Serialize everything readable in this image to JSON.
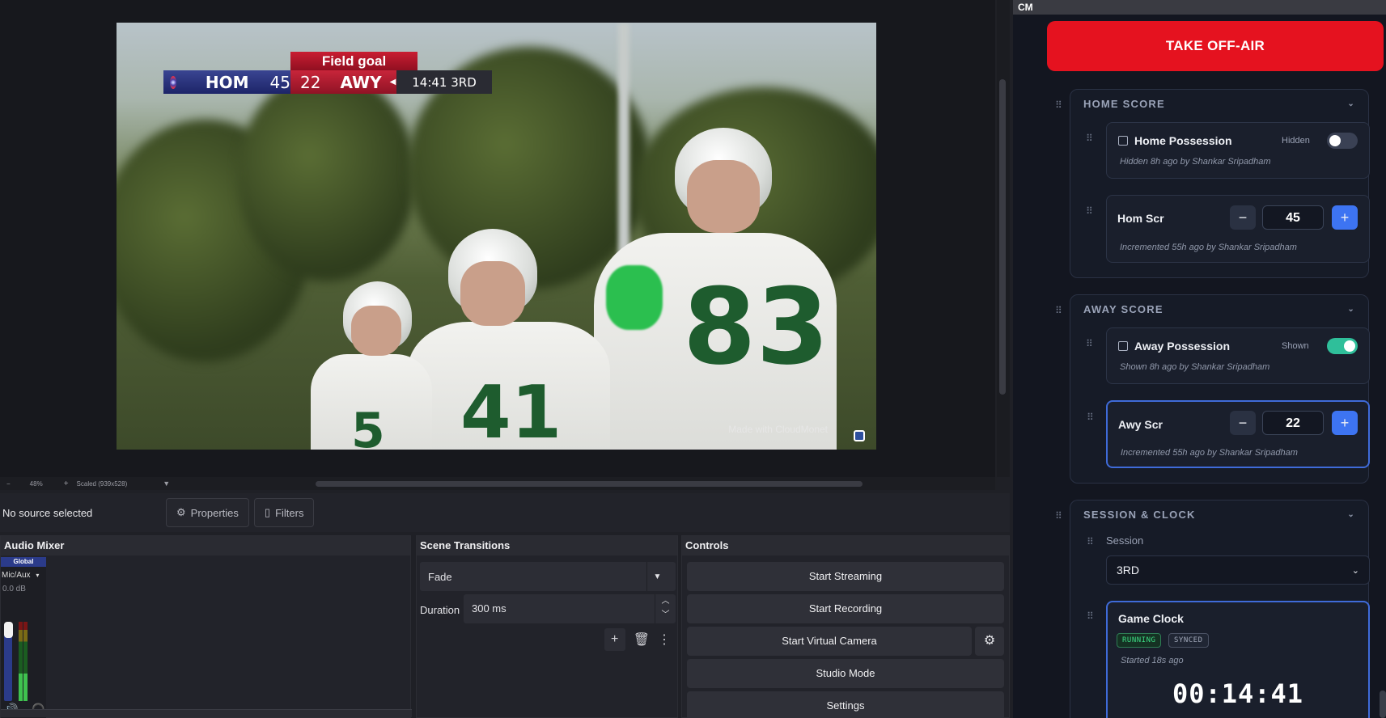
{
  "scorebug": {
    "title": "Field goal",
    "home_abbr": "HOM",
    "home_score": "45",
    "away_score": "22",
    "away_abbr": "AWY",
    "clock": "14:41 3RD"
  },
  "video": {
    "watermark": "Made with CloudMonet",
    "player_numbers": [
      "83",
      "41",
      "5"
    ]
  },
  "preview_bar": {
    "zoom_minus": "−",
    "zoom": "48%",
    "zoom_plus": "+",
    "scale": "Scaled (939x528)"
  },
  "source_toolbar": {
    "no_source": "No source selected",
    "properties": "Properties",
    "filters": "Filters"
  },
  "audio_mixer": {
    "title": "Audio Mixer",
    "global_label": "Global",
    "device": "Mic/Aux",
    "db": "0.0 dB"
  },
  "scene_transitions": {
    "title": "Scene Transitions",
    "transition": "Fade",
    "duration_label": "Duration",
    "duration_value": "300 ms"
  },
  "controls": {
    "title": "Controls",
    "start_streaming": "Start Streaming",
    "start_recording": "Start Recording",
    "start_virtual_camera": "Start Virtual Camera",
    "studio_mode": "Studio Mode",
    "settings": "Settings"
  },
  "panel": {
    "app_tag": "CM",
    "take_off_air": "TAKE OFF-AIR",
    "home_section": {
      "title": "HOME SCORE",
      "possession_label": "Home Possession",
      "possession_state": "Hidden",
      "possession_shown": false,
      "possession_meta": "Hidden 8h ago by Shankar Sripadham",
      "score_label": "Hom Scr",
      "score_value": "45",
      "score_meta": "Incremented 55h ago by Shankar Sripadham"
    },
    "away_section": {
      "title": "AWAY SCORE",
      "possession_label": "Away Possession",
      "possession_state": "Shown",
      "possession_shown": true,
      "possession_meta": "Shown 8h ago by Shankar Sripadham",
      "score_label": "Awy Scr",
      "score_value": "22",
      "score_meta": "Incremented 55h ago by Shankar Sripadham"
    },
    "session_section": {
      "title": "SESSION & CLOCK",
      "session_label": "Session",
      "session_value": "3RD",
      "clock_title": "Game Clock",
      "badge_running": "RUNNING",
      "badge_synced": "SYNCED",
      "clock_meta": "Started 18s ago",
      "clock_value": "00:14:41"
    }
  },
  "colors": {
    "accent_red": "#e5121f",
    "accent_blue": "#3f6bd9",
    "toggle_on": "#2fbf9a",
    "running_green": "#3ddc84"
  }
}
